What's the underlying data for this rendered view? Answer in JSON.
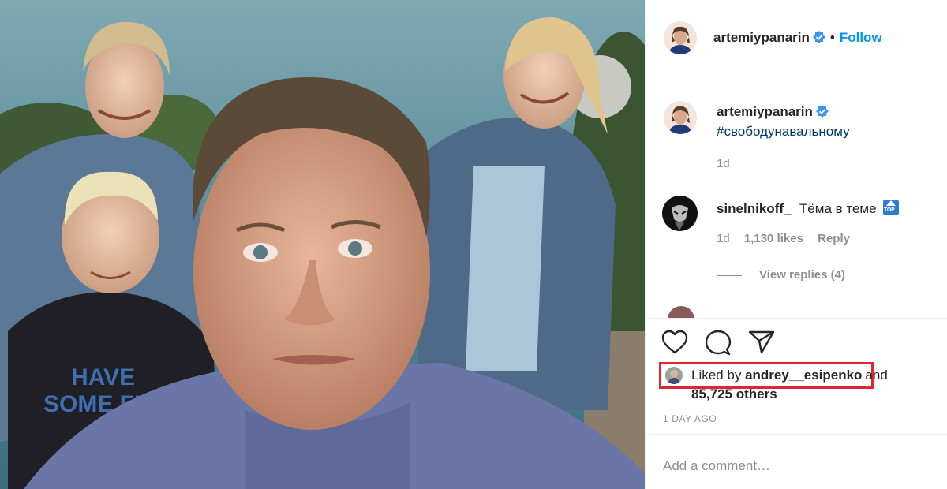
{
  "post": {
    "image_alt": "Selfie of a man with three family members in denim jackets in front of the sea"
  },
  "header": {
    "username": "artemiypanarin",
    "separator": "•",
    "follow_label": "Follow"
  },
  "caption": {
    "username": "artemiypanarin",
    "text": "#свободунавальному",
    "age": "1d"
  },
  "comments": [
    {
      "username": "sinelnikoff_",
      "text": "Тёма в теме",
      "emoji_label": "TOP",
      "age": "1d",
      "likes": "1,130 likes",
      "reply_label": "Reply",
      "view_replies": "View replies (4)"
    }
  ],
  "likes": {
    "prefix": "Liked by",
    "user": "andrey__esipenko",
    "conj": "and",
    "others": "85,725 others"
  },
  "timestamp": "1 DAY AGO",
  "add_comment": {
    "placeholder": "Add a comment…"
  },
  "colors": {
    "link_blue": "#0095f6",
    "hashtag": "#00376b",
    "highlight_box": "#e0272f",
    "muted": "#8e8e8e"
  }
}
